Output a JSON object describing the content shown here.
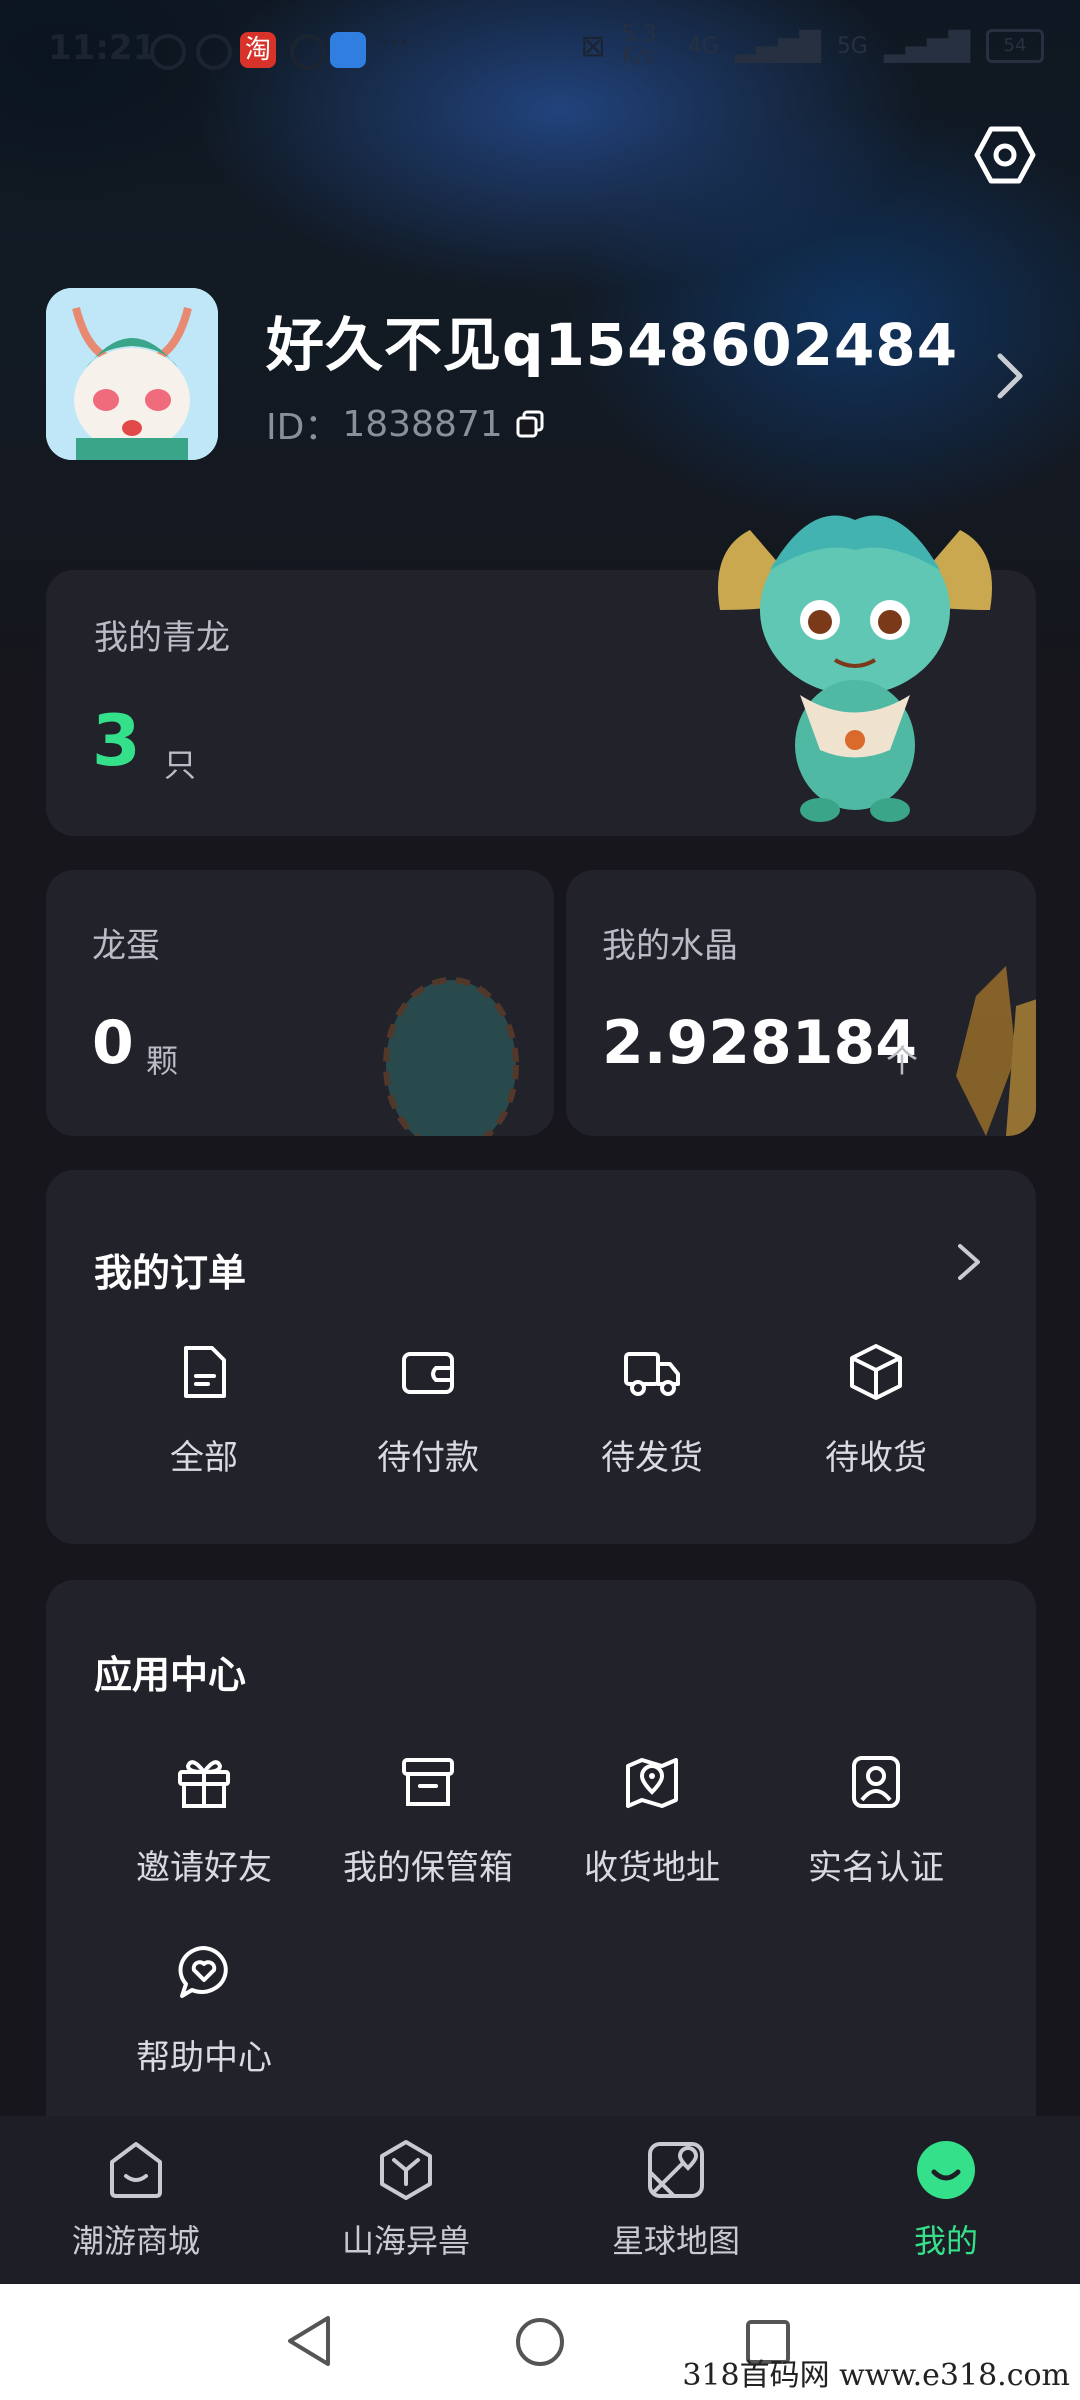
{
  "status_bar": {
    "time": "11:21",
    "speed": "5.3 K/s",
    "network1": "4G",
    "network2": "5G",
    "battery": "54"
  },
  "profile": {
    "username": "好久不见q1548602484",
    "id_label": "ID：",
    "id_value": "1838871"
  },
  "dragons": {
    "label": "我的青龙",
    "count": "3",
    "unit": "只"
  },
  "eggs": {
    "label": "龙蛋",
    "count": "0",
    "unit": "颗"
  },
  "crystals": {
    "label": "我的水晶",
    "count": "2.928184",
    "unit": "个"
  },
  "orders": {
    "title": "我的订单",
    "items": [
      {
        "label": "全部",
        "icon": "document-icon"
      },
      {
        "label": "待付款",
        "icon": "wallet-icon"
      },
      {
        "label": "待发货",
        "icon": "truck-icon"
      },
      {
        "label": "待收货",
        "icon": "box-icon"
      }
    ]
  },
  "app_center": {
    "title": "应用中心",
    "items": [
      {
        "label": "邀请好友",
        "icon": "gift-icon"
      },
      {
        "label": "我的保管箱",
        "icon": "archive-icon"
      },
      {
        "label": "收货地址",
        "icon": "map-pin-icon"
      },
      {
        "label": "实名认证",
        "icon": "id-card-icon"
      },
      {
        "label": "帮助中心",
        "icon": "chat-heart-icon"
      }
    ]
  },
  "bottom_nav": {
    "items": [
      {
        "label": "潮游商城",
        "icon": "shop-icon"
      },
      {
        "label": "山海异兽",
        "icon": "hexagon-y-icon"
      },
      {
        "label": "星球地图",
        "icon": "map-icon"
      },
      {
        "label": "我的",
        "icon": "smile-icon"
      }
    ],
    "active_color": "#35e08a"
  },
  "accent_color": "#35e08a",
  "watermark": "318首码网  www.e318.com"
}
